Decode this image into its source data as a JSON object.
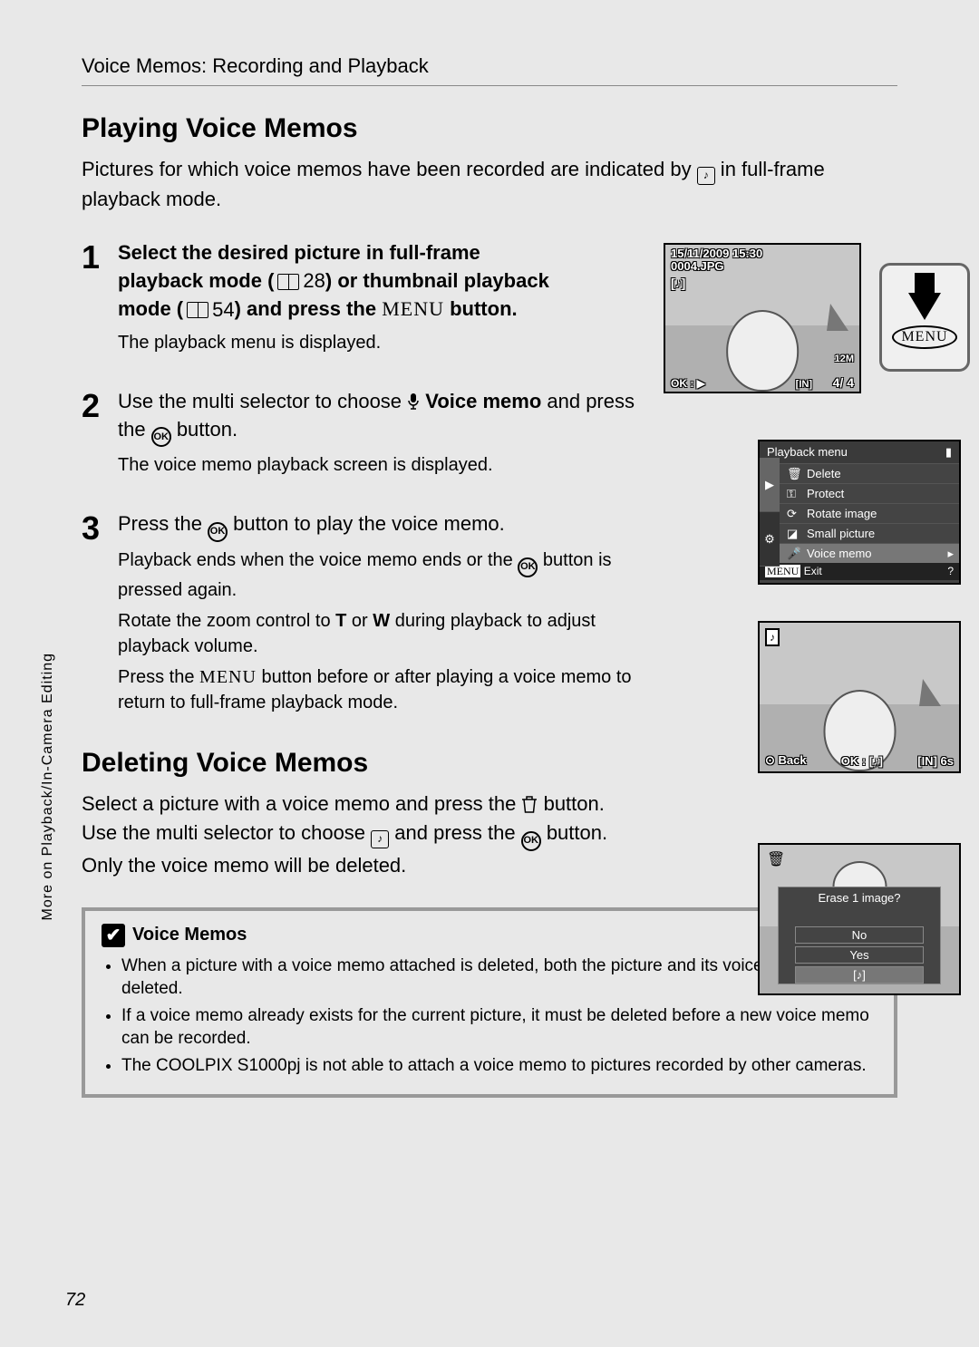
{
  "header": "Voice Memos: Recording and Playback",
  "side_tab": "More on Playback/In-Camera Editing",
  "page_number": "72",
  "sec1": {
    "title": "Playing Voice Memos",
    "intro_a": "Pictures for which voice memos have been recorded are indicated by ",
    "intro_b": " in full-frame playback mode."
  },
  "step1": {
    "num": "1",
    "t1": "Select the desired picture in full-frame playback mode (",
    "ref1": "28",
    "t2": ") or thumbnail playback mode (",
    "ref2": "54",
    "t3": ") and press the ",
    "menu": "MENU",
    "t4": " button.",
    "sub": "The playback menu is displayed."
  },
  "step2": {
    "num": "2",
    "t1": "Use the multi selector to choose ",
    "bold": "Voice memo",
    "t2": " and press the ",
    "t3": " button.",
    "sub": "The voice memo playback screen is displayed."
  },
  "step3": {
    "num": "3",
    "t1": "Press the ",
    "t2": " button to play the voice memo.",
    "p1a": "Playback ends when the voice memo ends or the ",
    "p1b": " button is pressed again.",
    "p2a": "Rotate the zoom control to ",
    "T": "T",
    "p2b": " or ",
    "W": "W",
    "p2c": " during playback to adjust playback volume.",
    "p3a": "Press the ",
    "menu": "MENU",
    "p3b": " button before or after playing a voice memo to return to full-frame playback mode."
  },
  "sec2": {
    "title": "Deleting Voice Memos",
    "p1a": "Select a picture with a voice memo and press the ",
    "p1b": " button. Use the multi selector to choose ",
    "p1c": " and press the ",
    "p1d": " button. Only the voice memo will be deleted."
  },
  "lcd1": {
    "timestamp": "15/11/2009 15:30",
    "filename": "0004.JPG",
    "mode": "12M",
    "counter": "4/ 4",
    "in": "IN"
  },
  "menu_button": "MENU",
  "lcd2": {
    "title": "Playback menu",
    "items": [
      {
        "label": "Delete"
      },
      {
        "label": "Protect"
      },
      {
        "label": "Rotate image"
      },
      {
        "label": "Small picture"
      },
      {
        "label": "Voice memo"
      }
    ],
    "exit_menu": "MENU",
    "exit": "Exit"
  },
  "lcd3": {
    "back": "Back",
    "ok": "OK",
    "in": "IN",
    "time": "6s"
  },
  "lcd4": {
    "prompt": "Erase 1 image?",
    "opt_no": "No",
    "opt_yes": "Yes"
  },
  "notes": {
    "title": "Voice Memos",
    "items": [
      "When a picture with a voice memo attached is deleted, both the picture and its voice memo are deleted.",
      "If a voice memo already exists for the current picture, it must be deleted before a new voice memo can be recorded.",
      "The COOLPIX S1000pj is not able to attach a voice memo to pictures recorded by other cameras."
    ]
  }
}
